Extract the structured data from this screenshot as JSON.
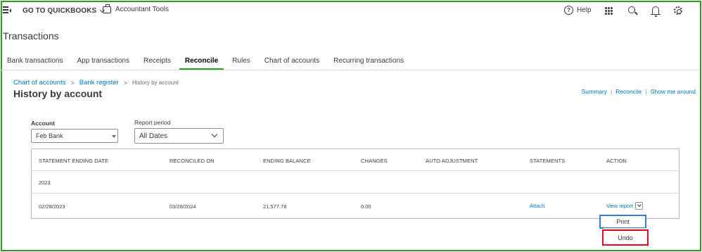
{
  "topbar": {
    "goto_label": "GO TO QUICKBOOKS",
    "accountant_tools": "Accountant Tools",
    "help_label": "Help"
  },
  "page": {
    "title": "Transactions"
  },
  "tabs": [
    {
      "label": "Bank transactions"
    },
    {
      "label": "App transactions"
    },
    {
      "label": "Receipts"
    },
    {
      "label": "Reconcile",
      "active": true
    },
    {
      "label": "Rules"
    },
    {
      "label": "Chart of accounts"
    },
    {
      "label": "Recurring transactions"
    }
  ],
  "breadcrumb": {
    "items": [
      "Chart of accounts",
      "Bank register"
    ],
    "separator": ">",
    "current": "History by account"
  },
  "heading": "History by account",
  "quicklinks": {
    "items": [
      "Summary",
      "Reconcile",
      "Show me around"
    ],
    "separator": "|"
  },
  "filters": {
    "account_label": "Account",
    "account_value": "Feb Bank",
    "period_label": "Report period",
    "period_value": "All Dates"
  },
  "table": {
    "headers": [
      "STATEMENT ENDING DATE",
      "RECONCILED ON",
      "ENDING BALANCE",
      "CHANGES",
      "AUTO ADJUSTMENT",
      "STATEMENTS",
      "ACTION"
    ],
    "group": "2023",
    "rows": [
      {
        "statement_ending_date": "02/28/2023",
        "reconciled_on": "03/28/2024",
        "ending_balance": "21,577.78",
        "changes": "0.00",
        "auto_adjustment": "",
        "statements": "Attach",
        "action": "View report"
      }
    ]
  },
  "action_menu": {
    "items": [
      "Print",
      "Undo"
    ]
  },
  "colors": {
    "accent_green": "#2ca01c",
    "link_blue": "#0077c5",
    "highlight_blue": "#3d7cc9",
    "highlight_red": "#e0081f"
  }
}
